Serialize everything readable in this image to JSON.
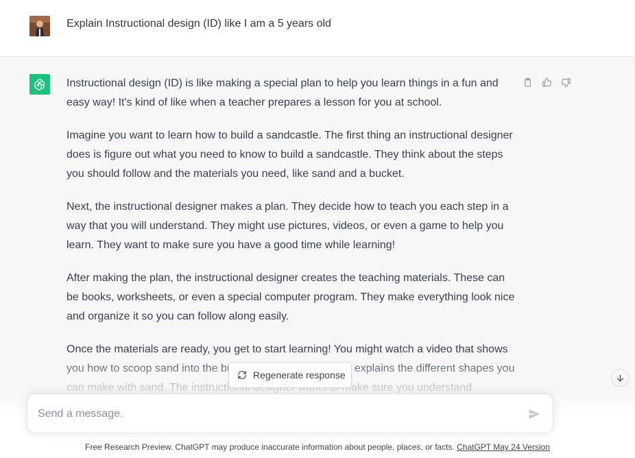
{
  "user": {
    "avatar_icon": "user-photo-avatar",
    "message": "Explain Instructional design (ID) like I am a 5 years old"
  },
  "assistant": {
    "avatar_icon": "openai-logo-icon",
    "brand_color": "#19c37d",
    "paragraphs": [
      "Instructional design (ID) is like making a special plan to help you learn things in a fun and easy way! It's kind of like when a teacher prepares a lesson for you at school.",
      "Imagine you want to learn how to build a sandcastle. The first thing an instructional designer does is figure out what you need to know to build a sandcastle. They think about the steps you should follow and the materials you need, like sand and a bucket.",
      "Next, the instructional designer makes a plan. They decide how to teach you each step in a way that you will understand. They might use pictures, videos, or even a game to help you learn. They want to make sure you have a good time while learning!",
      "After making the plan, the instructional designer creates the teaching materials. These can be books, worksheets, or even a special computer program. They make everything look nice and organize it so you can follow along easily.",
      "Once the materials are ready, you get to start learning! You might watch a video that shows you how to scoop sand into the bucket, or read a book that explains the different shapes you can make with sand. The instructional designer wants to make sure you understand"
    ],
    "actions": [
      "copy-icon",
      "thumbs-up-icon",
      "thumbs-down-icon"
    ]
  },
  "regenerate": {
    "label": "Regenerate response",
    "icon": "refresh-icon"
  },
  "scroll": {
    "icon": "arrow-down-icon"
  },
  "composer": {
    "placeholder": "Send a message.",
    "value": "",
    "send_icon": "send-icon"
  },
  "footer": {
    "text": "Free Research Preview. ChatGPT may produce inaccurate information about people, places, or facts. ",
    "link": "ChatGPT May 24 Version"
  }
}
